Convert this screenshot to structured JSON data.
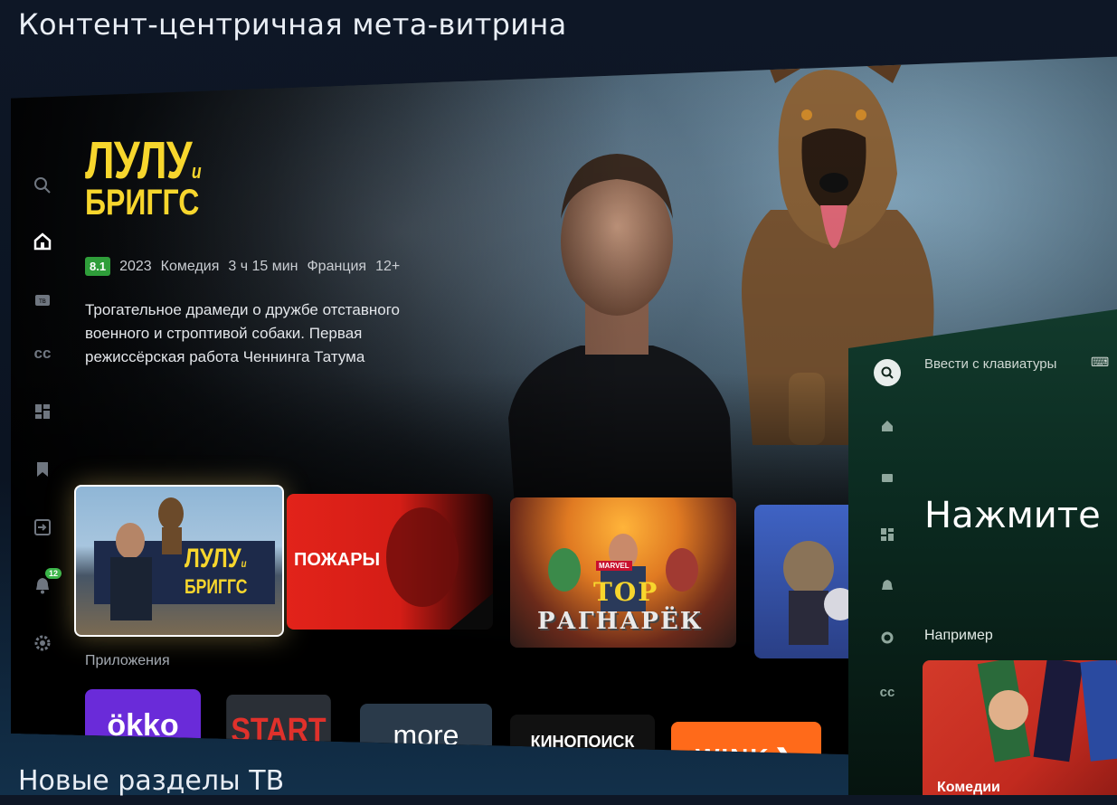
{
  "captions": {
    "top": "Контент-центричная мета-витрина",
    "bottom": "Новые разделы ТВ"
  },
  "sidebar": {
    "items": [
      {
        "name": "search-icon",
        "active": false
      },
      {
        "name": "home-icon",
        "active": true
      },
      {
        "name": "tv-icon",
        "active": false,
        "text": "ТВ"
      },
      {
        "name": "cc-icon",
        "active": false
      },
      {
        "name": "apps-grid-icon",
        "active": false
      },
      {
        "name": "bookmark-icon",
        "active": false
      },
      {
        "name": "input-source-icon",
        "active": false
      },
      {
        "name": "bell-icon",
        "active": false,
        "badge": "12"
      },
      {
        "name": "gear-icon",
        "active": false
      }
    ]
  },
  "hero": {
    "title_line1": "ЛУЛУ",
    "title_conj": "и",
    "title_line2": "БРИГГС",
    "rating": "8.1",
    "year": "2023",
    "genre": "Комедия",
    "duration": "3 ч 15 мин",
    "country": "Франция",
    "age": "12+",
    "description": "Трогательное драмеди о дружбе отставного военного и строптивой собаки. Первая режиссёрская работа Ченнинга Татума"
  },
  "cards": [
    {
      "title": "ЛУЛУ",
      "conj": "и",
      "title2": "БРИГГС",
      "selected": true
    },
    {
      "title": "ПОЖАРЫ"
    },
    {
      "title": "ТОР",
      "subtitle": "РАГНАРЁК",
      "brand": "MARVEL"
    },
    {
      "title": ""
    }
  ],
  "apps_section": {
    "label": "Приложения",
    "apps": [
      {
        "name": "ökko",
        "color": "#6a2bd9"
      },
      {
        "name": "START",
        "color": "#2a2f36",
        "text_color": "#e0312b"
      },
      {
        "name": "more",
        "color": "#2a3a4a"
      },
      {
        "name": "КИНОПОИСК",
        "color": "#111111"
      },
      {
        "name": "WINK",
        "color": "#ff6a1a"
      }
    ]
  },
  "panel": {
    "search_placeholder": "Ввести с клавиатуры",
    "prompt": "Нажмите",
    "example_label": "Например",
    "example_card": "Комедии",
    "accent": "#123a2c"
  },
  "colors": {
    "title_yellow": "#f7d62d",
    "rating_green": "#2f9e3a",
    "badge_green": "#39b54a",
    "pozhary_red": "#e2231a"
  }
}
